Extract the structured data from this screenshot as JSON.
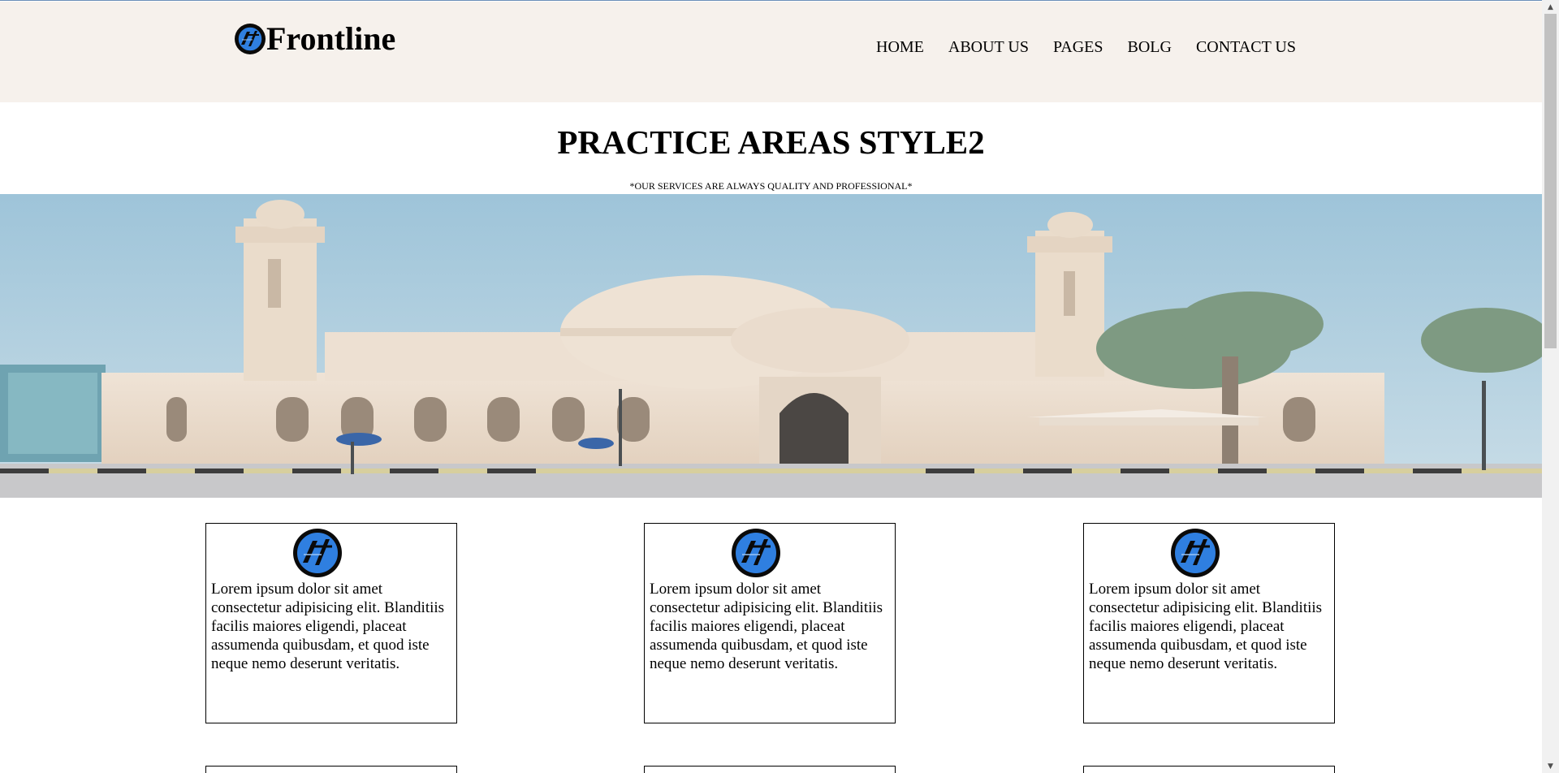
{
  "header": {
    "brand_name": "Frontline",
    "nav": [
      "HOME",
      "ABOUT US",
      "PAGES",
      "BOLG",
      "CONTACT US"
    ]
  },
  "hero_section": {
    "title": "PRACTICE AREAS STYLE2",
    "subtitle": "*OUR SERVICES ARE ALWAYS QUALITY AND PROFESSIONAL*"
  },
  "cards": [
    {
      "text": "Lorem ipsum dolor sit amet consectetur adipisicing elit. Blanditiis facilis maiores eligendi, placeat assumenda quibusdam, et quod iste neque nemo deserunt veritatis."
    },
    {
      "text": "Lorem ipsum dolor sit amet consectetur adipisicing elit. Blanditiis facilis maiores eligendi, placeat assumenda quibusdam, et quod iste neque nemo deserunt veritatis."
    },
    {
      "text": "Lorem ipsum dolor sit amet consectetur adipisicing elit. Blanditiis facilis maiores eligendi, placeat assumenda quibusdam, et quod iste neque nemo deserunt veritatis."
    }
  ],
  "icons": {
    "logo": "frontline-logo-icon",
    "card_icon": "frontline-logo-icon",
    "scroll_up": "chevron-up-icon",
    "scroll_down": "chevron-down-icon"
  },
  "colors": {
    "header_bg": "#f6f1ec",
    "logo_blue": "#2f7fe0",
    "text": "#000000"
  }
}
